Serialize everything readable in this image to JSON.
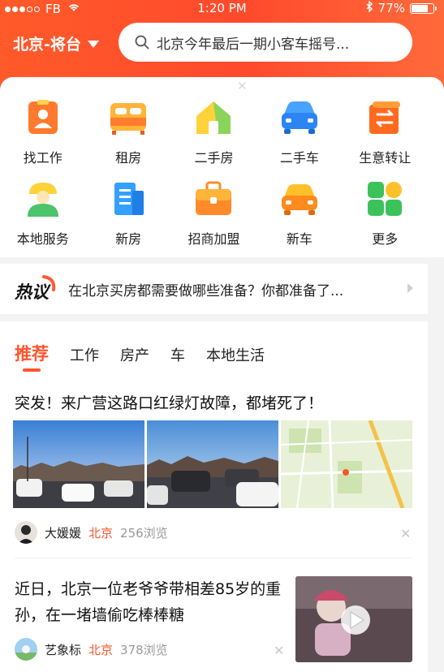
{
  "status": {
    "carrier": "FB",
    "time": "1:20 PM",
    "battery": "77%",
    "signal_filled": 3,
    "signal_total": 5,
    "battery_level": 0.77
  },
  "header": {
    "city": "北京-将台",
    "search_placeholder": "北京今年最后一期小客车摇号..."
  },
  "categories": [
    {
      "label": "找工作",
      "icon": "job-icon"
    },
    {
      "label": "租房",
      "icon": "bed-icon"
    },
    {
      "label": "二手房",
      "icon": "house-icon"
    },
    {
      "label": "二手车",
      "icon": "used-car-icon"
    },
    {
      "label": "生意转让",
      "icon": "transfer-icon"
    },
    {
      "label": "本地服务",
      "icon": "local-service-icon"
    },
    {
      "label": "新房",
      "icon": "building-icon"
    },
    {
      "label": "招商加盟",
      "icon": "briefcase-icon"
    },
    {
      "label": "新车",
      "icon": "new-car-icon"
    },
    {
      "label": "更多",
      "icon": "more-icon"
    }
  ],
  "hot": {
    "badge": "热议",
    "text": "在北京买房都需要做哪些准备？你都准备了..."
  },
  "tabs": [
    "推荐",
    "工作",
    "房产",
    "车",
    "本地生活"
  ],
  "articles": [
    {
      "title": "突发！来广营这路口红绿灯故障，都堵死了！",
      "author": "大媛媛",
      "location": "北京",
      "views": "256浏览"
    },
    {
      "title": "近日，北京一位老爷爷带相差85岁的重孙，在一堵墙偷吃棒棒糖",
      "author": "艺象标",
      "location": "北京",
      "views": "378浏览"
    }
  ],
  "colors": {
    "accent": "#ff552e",
    "header": "#ff4a2c"
  }
}
